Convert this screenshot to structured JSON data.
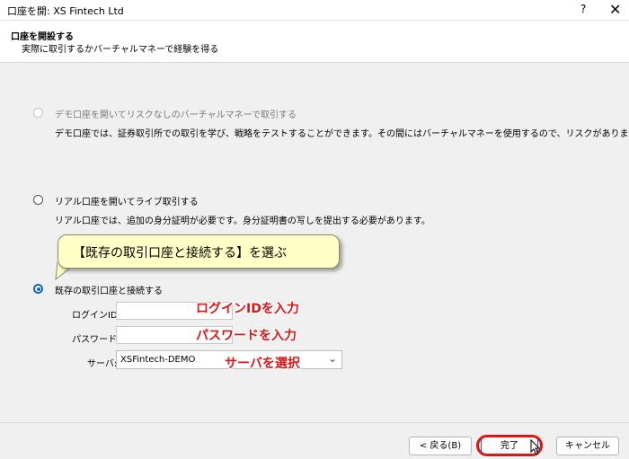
{
  "window": {
    "title": "口座を開: XS Fintech Ltd",
    "help_label": "?",
    "close_label": "✕"
  },
  "header": {
    "title": "口座を開設する",
    "subtitle": "実際に取引するかバーチャルマネーで経験を得る"
  },
  "options": [
    {
      "label": "デモ口座を開いてリスクなしのバーチャルマネーで取引する",
      "description": "デモ口座では、証券取引所での取引を学び、戦略をテストすることができます。その間にはバーチャルマネーを使用するので、リスクがありません。",
      "state": "disabled"
    },
    {
      "label": "リアル口座を開いてライブ取引する",
      "description": "リアル口座では、追加の身分証明が必要です。身分証明書の写しを提出する必要があります。",
      "state": "unchecked"
    },
    {
      "label": "既存の取引口座と接続する",
      "state": "checked"
    }
  ],
  "form": {
    "login_label": "ログインID:",
    "login_value": "",
    "password_label": "パスワード:",
    "password_value": "",
    "server_label": "サーバ:",
    "server_value": "XSFintech-DEMO"
  },
  "annotations": {
    "callout": "【既存の取引口座と接続する】を選ぶ",
    "login_hint": "ログインIDを入力",
    "password_hint": "パスワードを入力",
    "server_hint": "サーバを選択"
  },
  "footer": {
    "back_label": "< 戻る(B)",
    "finish_label": "完了",
    "cancel_label": "キャンセル"
  },
  "colors": {
    "accent": "#0067c0",
    "annotation_red": "#e01414",
    "callout_bg": "#ffffc6"
  },
  "icons": {
    "close": "close-icon",
    "help": "help-icon",
    "dropdown": "chevron-down-icon",
    "cursor": "mouse-pointer-icon"
  }
}
